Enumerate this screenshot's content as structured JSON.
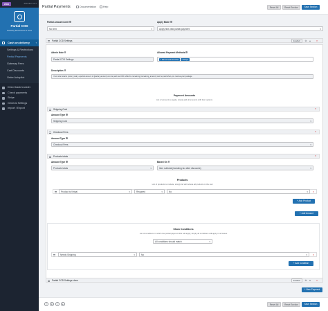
{
  "sidebar": {
    "woo_badge": "woo",
    "version": "Premium v1.x",
    "brand_name": "Partial COD",
    "brand_sub": "Gateway Restrictions & Fees",
    "main_item": "Cash on delivery",
    "sub_items": [
      "Settings & Restrictions",
      "Partial Payments",
      "Gateway Fees",
      "Cart Discounts",
      "Order Autopilot"
    ],
    "nav_items": [
      "Direct bank transfer",
      "Check payments",
      "Stripe",
      "General Settings",
      "Import / Export"
    ]
  },
  "header": {
    "title": "Partial Payments",
    "documentation": "Documentation",
    "help": "Help",
    "reset_all": "Reset All",
    "reset_section": "Reset Section",
    "save_section": "Save Section"
  },
  "general": {
    "limit_label": "Partial Amount Limit",
    "limit_value": "No limit",
    "apply_label": "Apply Mode",
    "apply_value": "Apply first valid partial payment"
  },
  "settings1": {
    "title": "Partial COD Settings",
    "enable": "Enable",
    "admin_note_label": "Admin Note",
    "admin_note_value": "Partial COD Settings",
    "allowed_label": "Allowed Payment Methods",
    "allowed_tags": [
      "× Direct bank transfer",
      "× Stripe"
    ],
    "desc_label": "Description",
    "desc_value": "Your order total is {order_total}, a partial amount of {partial_amount} can be paid via COD while the remaining {remaining_amount} can be paid when you receive your package"
  },
  "amounts": {
    "title": "Payment Amounts",
    "subtitle": "List of amounts to apply, simply add all amounts with their options",
    "items": [
      {
        "title": "Shipping Cost",
        "type_label": "Amount Type",
        "type_value": "Shipping Cost"
      },
      {
        "title": "Checkout Fees",
        "type_label": "Amount Type",
        "type_value": "Checkout Fees"
      },
      {
        "title": "Products totals",
        "type_label": "Amount Type",
        "type_value": "Products totals",
        "based_label": "Based On",
        "based_value": "Item subtotal (including tax after discounts)"
      }
    ],
    "products_title": "Products",
    "products_sub": "List of products to include, simply list will include all products in the cart",
    "product_row": {
      "col1": "Product is Virtual",
      "col2": "Required",
      "col3": "No"
    },
    "add_product": "+ Add Product",
    "add_amount": "+ Add Amount"
  },
  "conditions": {
    "title": "Show Conditions",
    "subtitle": "List of conditions in which the partial payment this will apply, simply all conditions will apply in all cases",
    "match_value": "All conditions should match",
    "row": {
      "col1": "Needs Shipping",
      "col2": "No"
    },
    "add_condition": "+ Add Condition"
  },
  "settings2": {
    "title": "Partial COD Settings clone",
    "enable": "Enable"
  },
  "new_payment": "+ New Payment",
  "footer": {
    "reset_all": "Reset All",
    "reset_section": "Reset Section",
    "save_section": "Save Section"
  }
}
